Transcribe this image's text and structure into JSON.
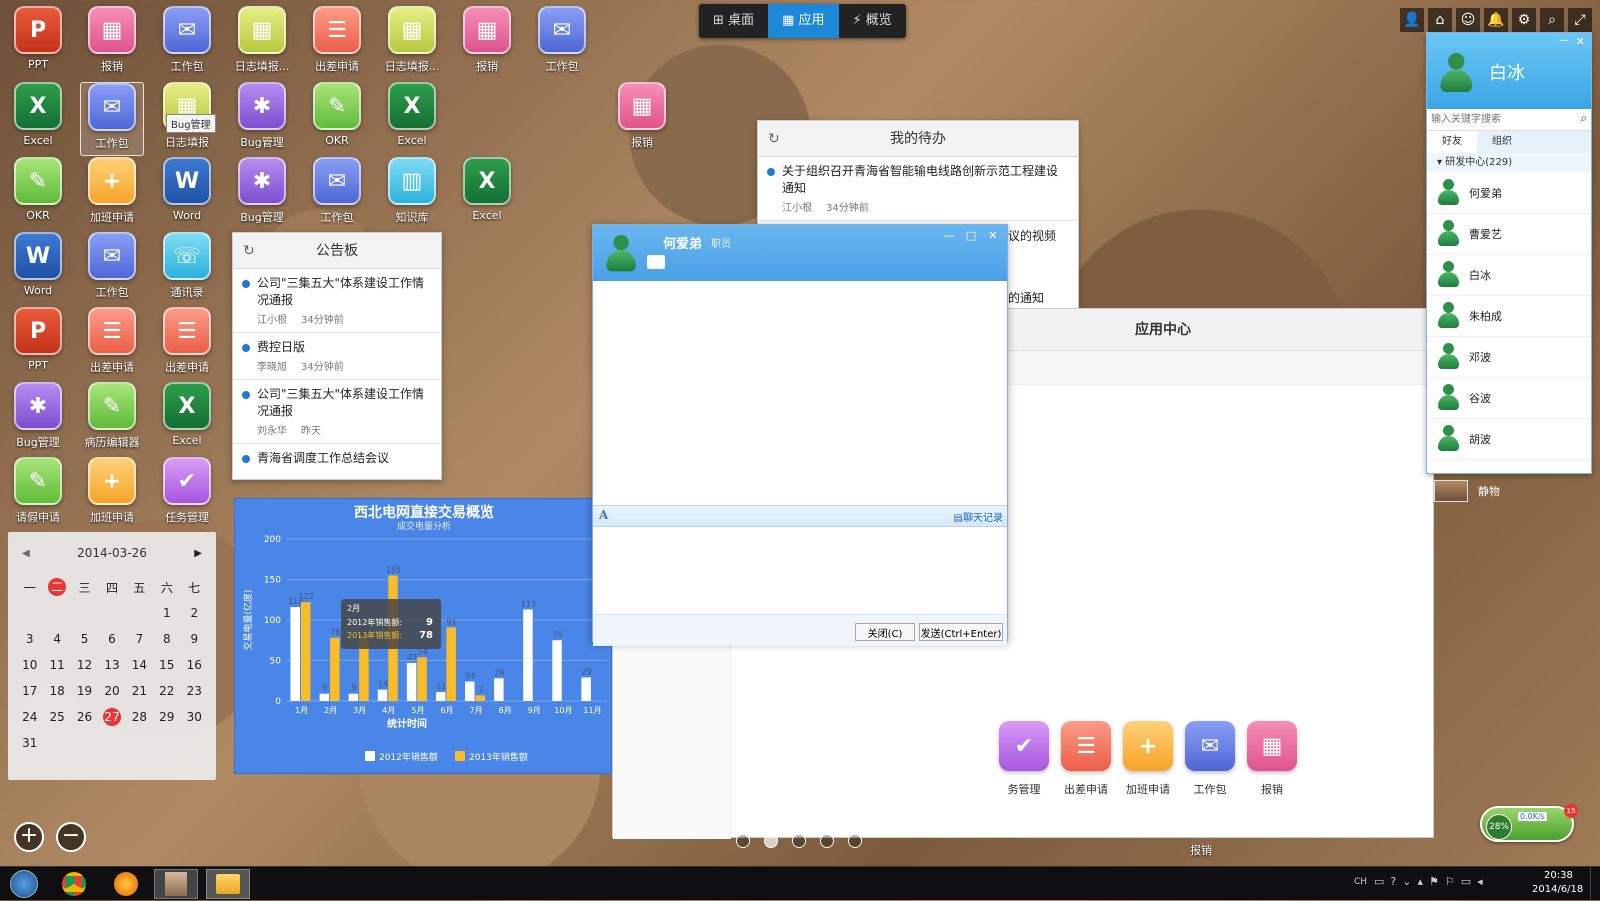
{
  "topnav": {
    "desktop": "桌面",
    "apps": "应用",
    "overview": "概览"
  },
  "desktop_icons": [
    {
      "label": "PPT",
      "glyph": "P",
      "color": "ppt"
    },
    {
      "label": "报销",
      "glyph": "▦",
      "color": "pink"
    },
    {
      "label": "工作包",
      "glyph": "✉",
      "color": "blue"
    },
    {
      "label": "日志填报...",
      "glyph": "▦",
      "color": "lime"
    },
    {
      "label": "出差申请",
      "glyph": "☰",
      "color": "coral"
    },
    {
      "label": "日志填报...",
      "glyph": "▦",
      "color": "lime"
    },
    {
      "label": "报销",
      "glyph": "▦",
      "color": "pink"
    },
    {
      "label": "工作包",
      "glyph": "✉",
      "color": "blue"
    },
    {
      "label": "Excel",
      "glyph": "X",
      "color": "xls"
    },
    {
      "label": "工作包",
      "glyph": "✉",
      "color": "blue"
    },
    {
      "label": "日志填报",
      "glyph": "▦",
      "color": "lime"
    },
    {
      "label": "Bug管理",
      "glyph": "✱",
      "color": "purple"
    },
    {
      "label": "OKR",
      "glyph": "✎",
      "color": "green"
    },
    {
      "label": "Excel",
      "glyph": "X",
      "color": "xls"
    },
    {
      "label": "报销",
      "glyph": "▦",
      "color": "pink"
    },
    {
      "label": "OKR",
      "glyph": "✎",
      "color": "green"
    },
    {
      "label": "加班申请",
      "glyph": "+",
      "color": "orange"
    },
    {
      "label": "Word",
      "glyph": "W",
      "color": "doc"
    },
    {
      "label": "Bug管理",
      "glyph": "✱",
      "color": "purple"
    },
    {
      "label": "工作包",
      "glyph": "✉",
      "color": "blue"
    },
    {
      "label": "知识库",
      "glyph": "▥",
      "color": "cyan"
    },
    {
      "label": "Excel",
      "glyph": "X",
      "color": "xls"
    },
    {
      "label": "Word",
      "glyph": "W",
      "color": "doc"
    },
    {
      "label": "工作包",
      "glyph": "✉",
      "color": "blue"
    },
    {
      "label": "通讯录",
      "glyph": "☏",
      "color": "cyan"
    },
    {
      "label": "PPT",
      "glyph": "P",
      "color": "ppt"
    },
    {
      "label": "出差申请",
      "glyph": "☰",
      "color": "coral"
    },
    {
      "label": "出差申请",
      "glyph": "☰",
      "color": "coral"
    },
    {
      "label": "Bug管理",
      "glyph": "✱",
      "color": "purple"
    },
    {
      "label": "病历编辑器",
      "glyph": "✎",
      "color": "green"
    },
    {
      "label": "Excel",
      "glyph": "X",
      "color": "xls"
    },
    {
      "label": "请假申请",
      "glyph": "✎",
      "color": "green"
    },
    {
      "label": "加班申请",
      "glyph": "+",
      "color": "orange"
    },
    {
      "label": "任务管理",
      "glyph": "✔",
      "color": "violet"
    }
  ],
  "tooltip_bug": "Bug管理",
  "bulletin": {
    "title": "公告板",
    "items": [
      {
        "title": "公司\"三集五大\"体系建设工作情况通报",
        "author": "江小根",
        "time": "34分钟前"
      },
      {
        "title": "费控日版",
        "author": "李晓旭",
        "time": "34分钟前"
      },
      {
        "title": "公司\"三集五大\"体系建设工作情况通报",
        "author": "刘永华",
        "time": "昨天"
      },
      {
        "title": "青海省调度工作总结会议",
        "author": "",
        "time": ""
      }
    ]
  },
  "todo": {
    "title": "我的待办",
    "items": [
      {
        "title": "关于组织召开青海省智能输电线路创新示范工程建设通知",
        "author": "江小根",
        "time": "34分钟前"
      },
      {
        "title": "议的视频"
      },
      {
        "title": "的通知"
      }
    ]
  },
  "calendar": {
    "date": "2014-03-26",
    "weekdays": [
      "一",
      "二",
      "三",
      "四",
      "五",
      "六",
      "七"
    ],
    "weeks": [
      [
        "",
        "",
        "",
        "",
        "",
        "1",
        "2"
      ],
      [
        "3",
        "4",
        "5",
        "6",
        "7",
        "8",
        "9"
      ],
      [
        "10",
        "11",
        "12",
        "13",
        "14",
        "15",
        "16"
      ],
      [
        "17",
        "18",
        "19",
        "20",
        "21",
        "22",
        "23"
      ],
      [
        "24",
        "25",
        "26",
        "27",
        "28",
        "29",
        "30"
      ],
      [
        "31",
        "",
        "",
        "",
        "",
        "",
        ""
      ]
    ],
    "today": "27",
    "prev_arrow": "◀",
    "next_arrow": "▶"
  },
  "desktop_buttons": {
    "add": "+",
    "remove": "−"
  },
  "chart_data": {
    "type": "bar",
    "title": "西北电网直接交易概览",
    "subtitle": "成交电量分析",
    "xlabel": "统计时间",
    "ylabel": "交易电量(亿度)",
    "ylim": [
      0,
      200
    ],
    "yticks": [
      0,
      50,
      100,
      150,
      200
    ],
    "categories": [
      "1月",
      "2月",
      "3月",
      "4月",
      "5月",
      "6月",
      "7月",
      "8月",
      "9月",
      "10月",
      "11月"
    ],
    "series": [
      {
        "name": "2012年销售额",
        "color": "#ffffff",
        "values": [
          116,
          9,
          9,
          14,
          47,
          11,
          24,
          28,
          113,
          75,
          29
        ]
      },
      {
        "name": "2013年销售额",
        "color": "#fbbd26",
        "values": [
          122,
          78,
          81,
          155,
          54,
          91,
          7,
          0,
          0,
          0,
          0
        ]
      }
    ],
    "tooltip": {
      "category": "2月",
      "rows": [
        {
          "name": "2012年销售额",
          "value": "9"
        },
        {
          "name": "2013年销售额",
          "value": "78"
        }
      ]
    }
  },
  "chat": {
    "contact": "何爱弟",
    "status": "职员",
    "font_btn": "A",
    "history": "聊天记录",
    "close": "关闭(C)",
    "send": "发送(Ctrl+Enter)",
    "win_min": "—",
    "win_max": "□",
    "win_close": "✕"
  },
  "app_center": {
    "title": "应用中心",
    "apps": [
      {
        "label": "务管理",
        "glyph": "✔",
        "color": "violet"
      },
      {
        "label": "出差申请",
        "glyph": "☰",
        "color": "coral"
      },
      {
        "label": "加班申请",
        "glyph": "+",
        "color": "orange"
      },
      {
        "label": "工作包",
        "glyph": "✉",
        "color": "blue"
      },
      {
        "label": "报销",
        "glyph": "▦",
        "color": "pink"
      }
    ]
  },
  "dock_label": "报销",
  "buddy": {
    "name": "白冰",
    "search_placeholder": "输入关键字搜索",
    "tabs": [
      "好友",
      "组织"
    ],
    "group": "研发中心(229)",
    "members": [
      "何爱弟",
      "曹爱艺",
      "白冰",
      "朱柏成",
      "邓波",
      "谷波",
      "胡波"
    ],
    "collapsed_label": "静物"
  },
  "net_widget": {
    "percent": "28%",
    "speed": "0.0K/s",
    "badge": "15"
  },
  "taskbar": {
    "lang": "CH",
    "time": "20:38",
    "date": "2014/6/18"
  }
}
